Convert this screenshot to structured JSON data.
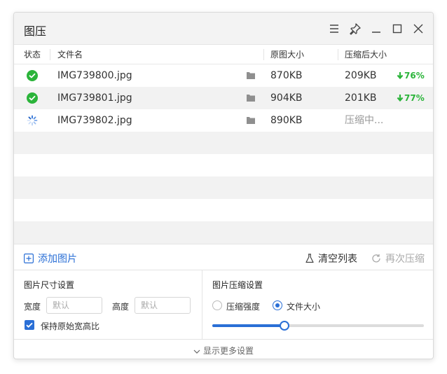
{
  "window": {
    "title": "图压"
  },
  "titlebar": {
    "icons": [
      "menu-icon",
      "pin-icon",
      "minimize-icon",
      "maximize-icon",
      "close-icon"
    ]
  },
  "table": {
    "headers": {
      "status": "状态",
      "filename": "文件名",
      "original_size": "原图大小",
      "compressed_size": "压缩后大小"
    },
    "rows": [
      {
        "status": "done",
        "filename": "IMG739800.jpg",
        "original_size": "870KB",
        "compressed_size": "209KB",
        "ratio": "76%"
      },
      {
        "status": "done",
        "filename": "IMG739801.jpg",
        "original_size": "904KB",
        "compressed_size": "201KB",
        "ratio": "77%"
      },
      {
        "status": "loading",
        "filename": "IMG739802.jpg",
        "original_size": "890KB",
        "compressed_size": "压缩中...",
        "ratio": ""
      }
    ]
  },
  "actions": {
    "add_label": "添加图片",
    "clear_label": "清空列表",
    "recompress_label": "再次压缩"
  },
  "size_settings": {
    "title": "图片尺寸设置",
    "width_label": "宽度",
    "width_placeholder": "默认",
    "height_label": "高度",
    "height_placeholder": "默认",
    "keep_ratio_label": "保持原始宽高比",
    "keep_ratio_checked": true
  },
  "compress_settings": {
    "title": "图片压缩设置",
    "option_strength": "压缩强度",
    "option_filesize": "文件大小",
    "selected": "文件大小",
    "slider_fraction": 0.34
  },
  "footer": {
    "more_label": "显示更多设置"
  },
  "colors": {
    "accent": "#2a6fd6",
    "success": "#2bb43a",
    "stripe": "#f2f2f2"
  }
}
